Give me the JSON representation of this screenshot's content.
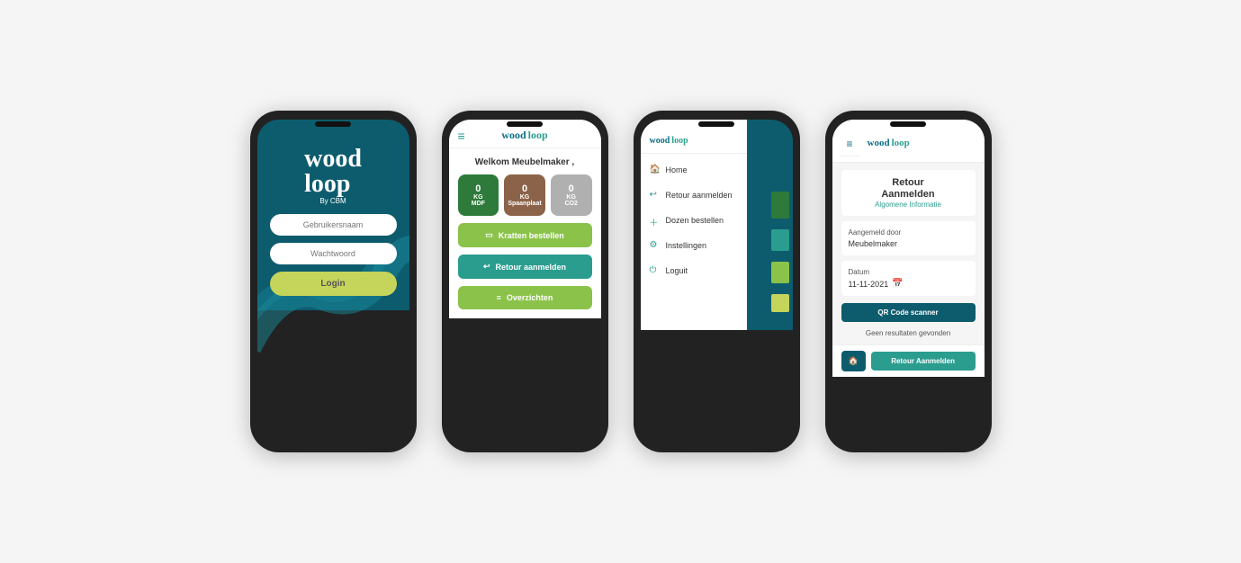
{
  "phone1": {
    "logo_wood": "wood",
    "logo_loop": "loop",
    "logo_cbm": "By CBM",
    "input_username": "Gebruikersnaam",
    "input_password": "Wachtwoord",
    "button_login": "Login"
  },
  "phone2": {
    "header_logo": "wood loop",
    "welcome": "Welkom Meubelmaker ,",
    "stat1_num": "0",
    "stat1_label1": "KG",
    "stat1_label2": "MDF",
    "stat2_num": "0",
    "stat2_label1": "KG",
    "stat2_label2": "Spaanplaat",
    "stat3_num": "0",
    "stat3_label1": "KG",
    "stat3_label2": "CO2",
    "btn1": "Kratten bestellen",
    "btn2": "Retour aanmelden",
    "btn3": "Overzichten"
  },
  "phone3": {
    "menu_items": [
      {
        "label": "Home",
        "icon": "🏠"
      },
      {
        "label": "Retour aanmelden",
        "icon": "↩"
      },
      {
        "label": "Dozen bestellen",
        "icon": "+"
      },
      {
        "label": "Instellingen",
        "icon": "⚙"
      },
      {
        "label": "Loguit",
        "icon": "⏻"
      }
    ],
    "colors": [
      "#2d7a3a",
      "#2a9d8f",
      "#8bc34a",
      "#c5d45a"
    ]
  },
  "phone4": {
    "header_logo": "wood loop",
    "page_title": "Retour\nAanmelden",
    "page_subtitle": "Algomene Informatie",
    "field1_label": "Aangemeld door",
    "field1_value": "Meubelmaker",
    "field2_label": "Datum",
    "field2_value": "11-11-2021",
    "btn_qr": "QR Code scanner",
    "no_results": "Geen resultaten gevonden",
    "btn_retour": "Retour Aanmelden",
    "btn_home_icon": "🏠"
  }
}
